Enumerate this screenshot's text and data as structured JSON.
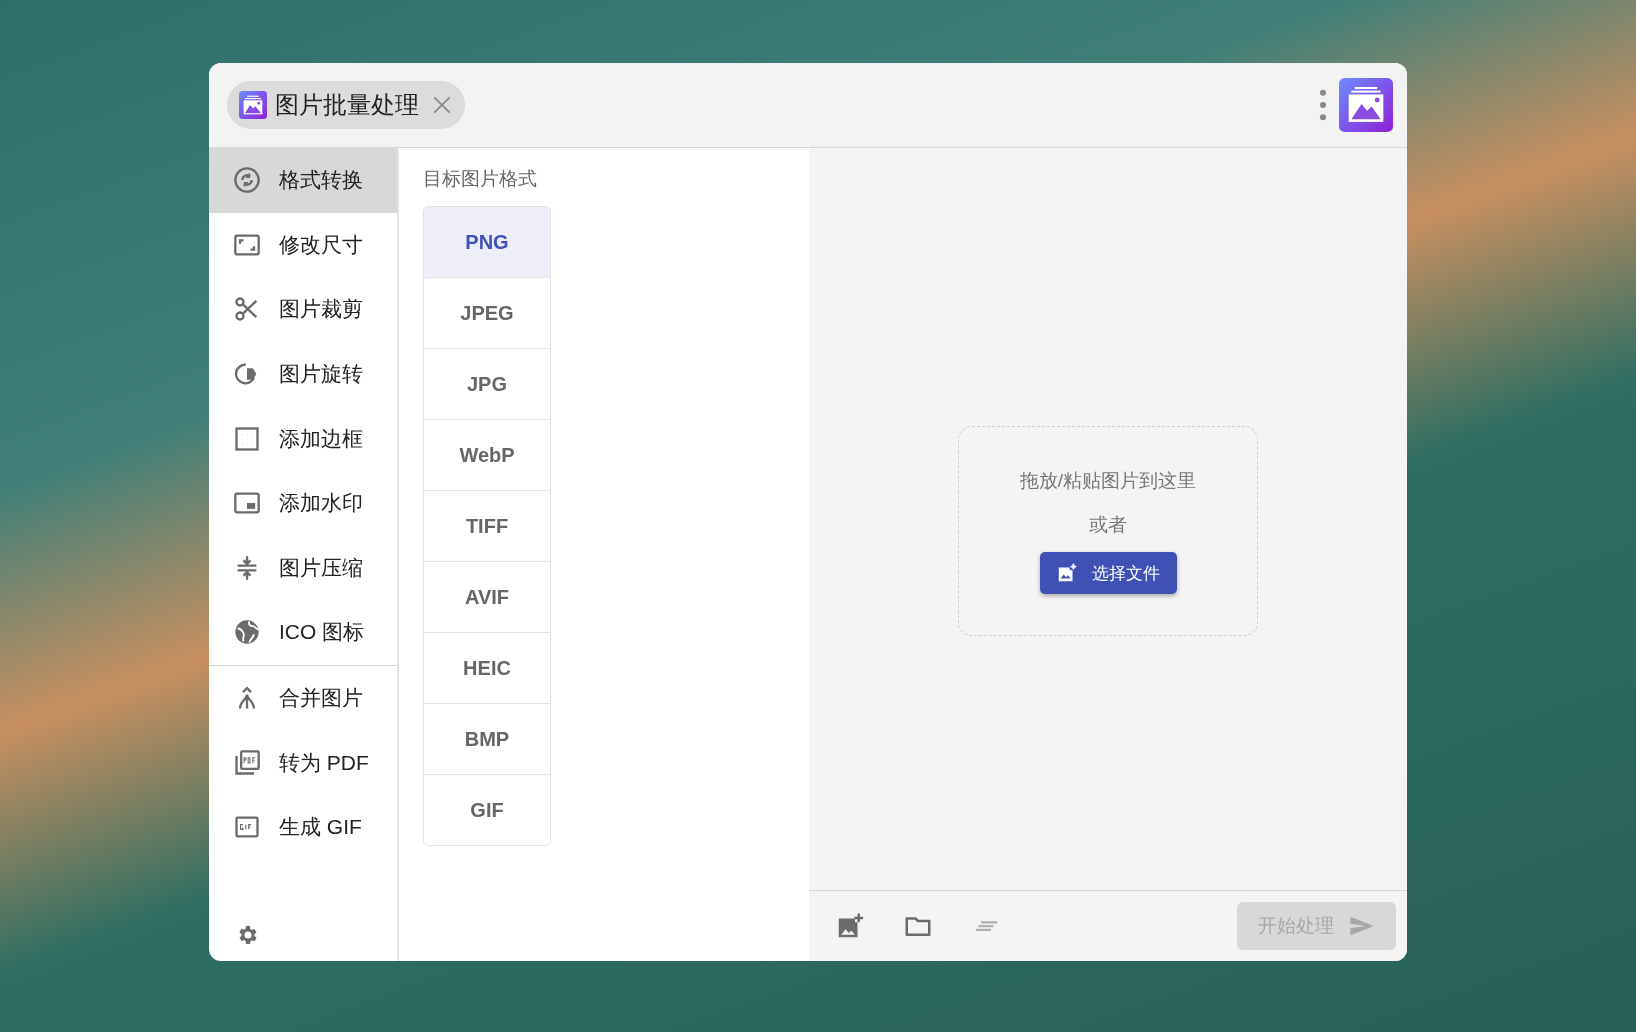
{
  "tab": {
    "title": "图片批量处理"
  },
  "sidebar": {
    "groups": [
      {
        "items": [
          {
            "label": "格式转换",
            "selected": true
          },
          {
            "label": "修改尺寸",
            "selected": false
          },
          {
            "label": "图片裁剪",
            "selected": false
          },
          {
            "label": "图片旋转",
            "selected": false
          },
          {
            "label": "添加边框",
            "selected": false
          },
          {
            "label": "添加水印",
            "selected": false
          },
          {
            "label": "图片压缩",
            "selected": false
          },
          {
            "label": "ICO 图标",
            "selected": false
          }
        ]
      },
      {
        "items": [
          {
            "label": "合并图片",
            "selected": false
          },
          {
            "label": "转为 PDF",
            "selected": false
          },
          {
            "label": "生成 GIF",
            "selected": false
          }
        ]
      }
    ]
  },
  "formats": {
    "title": "目标图片格式",
    "options": [
      {
        "label": "PNG",
        "selected": true
      },
      {
        "label": "JPEG",
        "selected": false
      },
      {
        "label": "JPG",
        "selected": false
      },
      {
        "label": "WebP",
        "selected": false
      },
      {
        "label": "TIFF",
        "selected": false
      },
      {
        "label": "AVIF",
        "selected": false
      },
      {
        "label": "HEIC",
        "selected": false
      },
      {
        "label": "BMP",
        "selected": false
      },
      {
        "label": "GIF",
        "selected": false
      }
    ]
  },
  "dropzone": {
    "hint": "拖放/粘贴图片到这里",
    "or": "或者",
    "button": "选择文件"
  },
  "footer": {
    "start": {
      "label": "开始处理",
      "disabled": true
    }
  }
}
